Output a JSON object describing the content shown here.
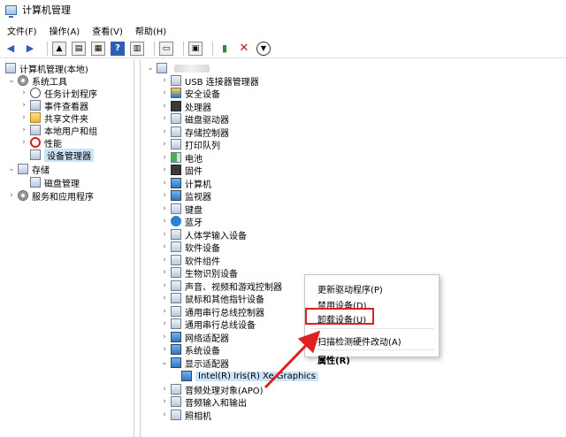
{
  "window": {
    "title": "计算机管理"
  },
  "menubar": {
    "file": "文件(F)",
    "action": "操作(A)",
    "view": "查看(V)",
    "help": "帮助(H)"
  },
  "left_tree": {
    "root": "计算机管理(本地)",
    "system_tools": "系统工具",
    "task_scheduler": "任务计划程序",
    "event_viewer": "事件查看器",
    "shared_folders": "共享文件夹",
    "local_users": "本地用户和组",
    "performance": "性能",
    "device_manager": "设备管理器",
    "storage": "存储",
    "disk_management": "磁盘管理",
    "services": "服务和应用程序"
  },
  "device_tree": [
    "USB 连接器管理器",
    "安全设备",
    "处理器",
    "磁盘驱动器",
    "存储控制器",
    "打印队列",
    "电池",
    "固件",
    "计算机",
    "监视器",
    "键盘",
    "蓝牙",
    "人体学输入设备",
    "软件设备",
    "软件组件",
    "生物识别设备",
    "声音、视频和游戏控制器",
    "鼠标和其他指针设备",
    "通用串行总线控制器",
    "通用串行总线设备",
    "网络适配器",
    "系统设备",
    "显示适配器",
    "Intel(R) Iris(R) Xe Graphics",
    "音频处理对象(APO)",
    "音频输入和输出",
    "照相机"
  ],
  "context_menu": {
    "update_driver": "更新驱动程序(P)",
    "disable_device": "禁用设备(D)",
    "uninstall_device": "卸载设备(U)",
    "scan_hardware": "扫描检测硬件改动(A)",
    "properties": "属性(R)"
  },
  "colors": {
    "highlight_red": "#e02020",
    "selection_blue": "#cce4f7",
    "arrow_red": "#e02020"
  }
}
